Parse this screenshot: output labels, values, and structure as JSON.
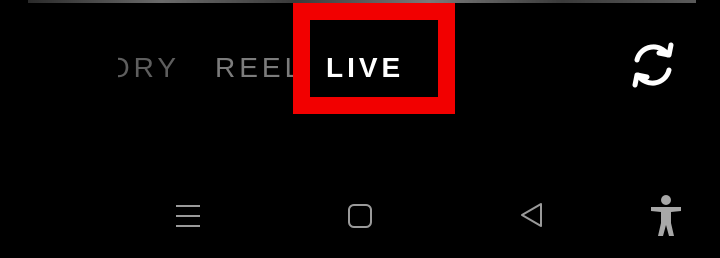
{
  "top_strip": {
    "description_icon": "preview-edge"
  },
  "mode_tabs": {
    "items": [
      {
        "label": "STORY",
        "selected": false
      },
      {
        "label": "REEL",
        "selected": false
      },
      {
        "label": "LIVE",
        "selected": true
      }
    ]
  },
  "highlight": {
    "color": "#f20000"
  },
  "camera_controls": {
    "flip_icon": "flip-camera-icon"
  },
  "navigation_bar": {
    "items": [
      {
        "icon": "recents-icon"
      },
      {
        "icon": "home-icon"
      },
      {
        "icon": "back-icon"
      },
      {
        "icon": "accessibility-icon"
      }
    ]
  }
}
